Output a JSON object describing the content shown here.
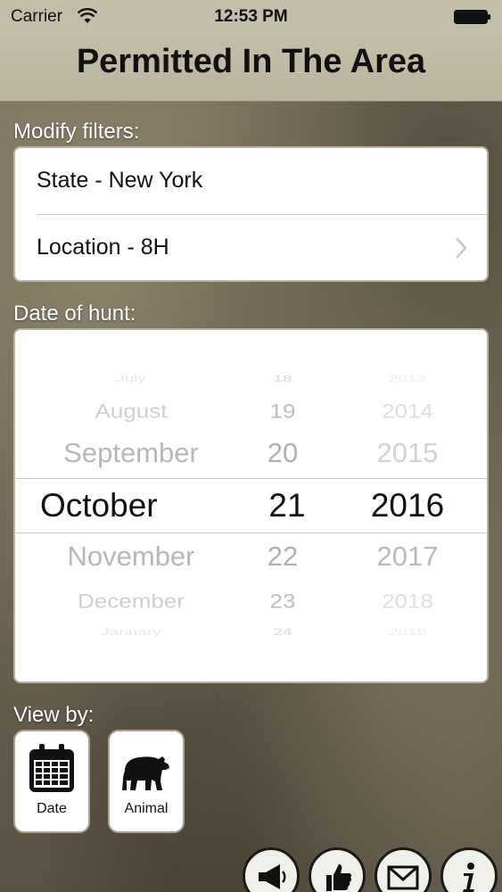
{
  "status_bar": {
    "carrier": "Carrier",
    "time": "12:53 PM"
  },
  "header": {
    "title": "Permitted In The Area"
  },
  "filters": {
    "section_label": "Modify filters:",
    "state": "State - New York",
    "location": "Location - 8H"
  },
  "date_picker": {
    "section_label": "Date of hunt:",
    "months": [
      "July",
      "August",
      "September",
      "October",
      "November",
      "December",
      "January"
    ],
    "days": [
      "18",
      "19",
      "20",
      "21",
      "22",
      "23",
      "24"
    ],
    "years": [
      "2013",
      "2014",
      "2015",
      "2016",
      "2017",
      "2018",
      "2019"
    ],
    "selected": {
      "month": "October",
      "day": "21",
      "year": "2016"
    }
  },
  "view_by": {
    "section_label": "View by:",
    "date_label": "Date",
    "animal_label": "Animal"
  },
  "bottom_icons": [
    "megaphone-icon",
    "thumbs-up-icon",
    "envelope-icon",
    "info-icon"
  ],
  "colors": {
    "header_bg": "#c2bea9",
    "card_bg": "#ffffff",
    "selected_text": "#111111",
    "faded_text": "#bdbdbd"
  }
}
